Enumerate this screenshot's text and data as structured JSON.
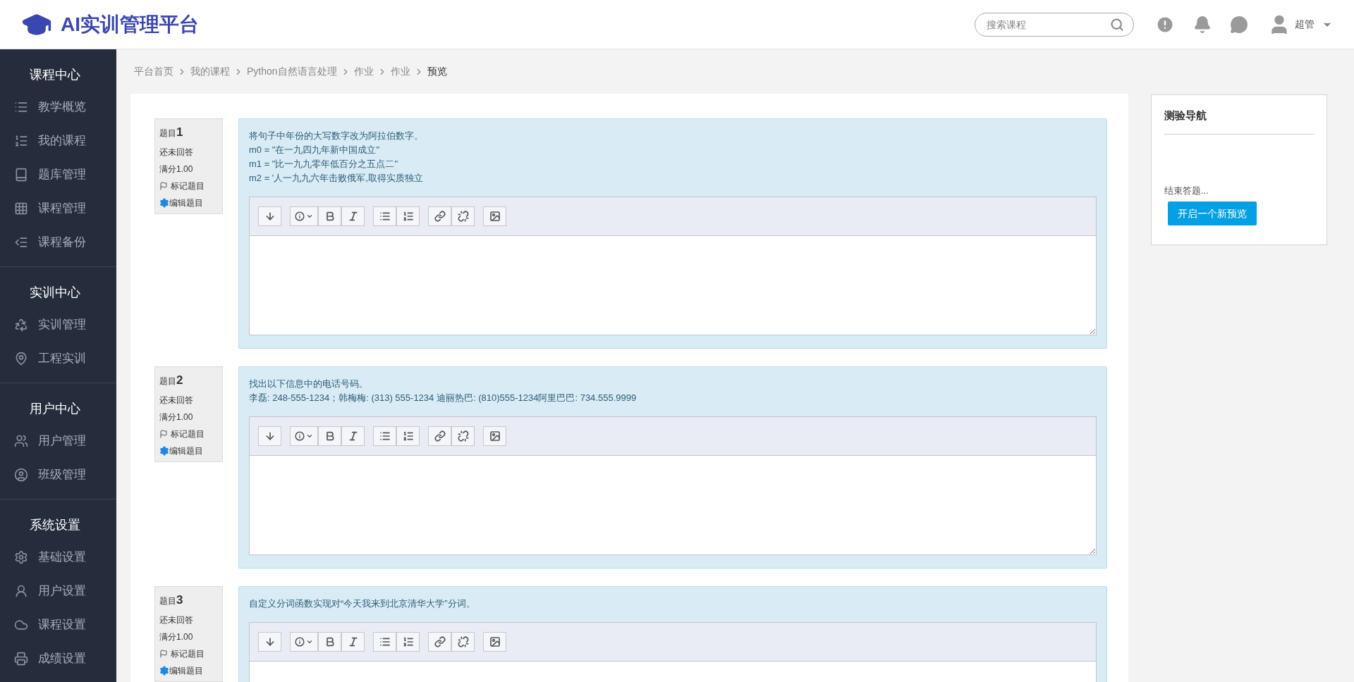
{
  "header": {
    "title": "AI实训管理平台",
    "search": {
      "placeholder": "搜索课程"
    },
    "user": "超管"
  },
  "sidebar": {
    "sections": [
      {
        "title": "课程中心",
        "items": [
          "教学概览",
          "我的课程",
          "题库管理",
          "课程管理",
          "课程备份"
        ]
      },
      {
        "title": "实训中心",
        "items": [
          "实训管理",
          "工程实训"
        ]
      },
      {
        "title": "用户中心",
        "items": [
          "用户管理",
          "班级管理"
        ]
      },
      {
        "title": "系统设置",
        "items": [
          "基础设置",
          "用户设置",
          "课程设置",
          "成绩设置"
        ]
      }
    ]
  },
  "breadcrumb": [
    "平台首页",
    "我的课程",
    "Python自然语言处理",
    "作业",
    "作业",
    "预览"
  ],
  "questions": [
    {
      "label": "题目",
      "number": "1",
      "status": "还未回答",
      "score": "满分1.00",
      "flag": "标记题目",
      "edit": "编辑题目",
      "lines": [
        "将句子中年份的大写数字改为阿拉伯数字。",
        "m0 = \"在一九四九年新中国成立\"",
        "m1 = \"比一九九零年低百分之五点二\"",
        "m2 = '人一九九六年击败俄军,取得实质独立"
      ]
    },
    {
      "label": "题目",
      "number": "2",
      "status": "还未回答",
      "score": "满分1.00",
      "flag": "标记题目",
      "edit": "编辑题目",
      "lines": [
        "找出以下信息中的电话号码。",
        "李磊: 248-555-1234；韩梅梅: (313) 555-1234 迪丽热巴: (810)555-1234阿里巴巴: 734.555.9999"
      ]
    },
    {
      "label": "题目",
      "number": "3",
      "status": "还未回答",
      "score": "满分1.00",
      "flag": "标记题目",
      "edit": "编辑题目",
      "lines": [
        "自定义分词函数实现对“今天我来到北京清华大学”分词。"
      ]
    }
  ],
  "quiz_nav": {
    "title": "测验导航",
    "finish": "结束答题...",
    "button": "开启一个新预览"
  }
}
